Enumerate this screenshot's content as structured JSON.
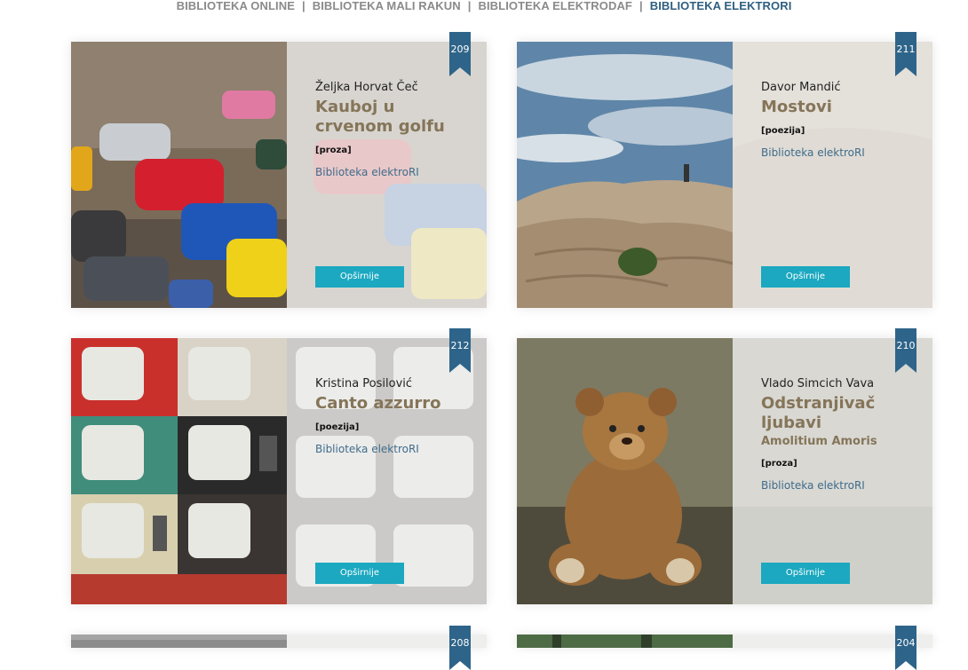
{
  "nav": {
    "items": [
      {
        "label": "BIBLIOTEKA ONLINE"
      },
      {
        "label": "BIBLIOTEKA MALI RAKUN"
      },
      {
        "label": "BIBLIOTEKA ELEKTRODAF"
      },
      {
        "label": "BIBLIOTEKA ELEKTRORI"
      }
    ],
    "separator": "|",
    "active_color": "#2f5f80"
  },
  "cards": [
    {
      "number": "209",
      "author": "Željka Horvat Čeč",
      "title": "Kauboj u crvenom golfu",
      "subtitle": "",
      "genre": "[proza]",
      "library": "Biblioteka elektroRI",
      "button": "Opširnije"
    },
    {
      "number": "211",
      "author": "Davor Mandić",
      "title": "Mostovi",
      "subtitle": "",
      "genre": "[poezija]",
      "library": "Biblioteka elektroRI",
      "button": "Opširnije"
    },
    {
      "number": "212",
      "author": "Kristina Posilović",
      "title": "Canto azzurro",
      "subtitle": "",
      "genre": "[poezija]",
      "library": "Biblioteka elektroRI",
      "button": "Opširnije"
    },
    {
      "number": "210",
      "author": "Vlado Simcich Vava",
      "title": "Odstranjivač ljubavi",
      "subtitle": "Amolitium Amoris",
      "genre": "[proza]",
      "library": "Biblioteka elektroRI",
      "button": "Opširnije"
    },
    {
      "number": "208"
    },
    {
      "number": "204"
    }
  ],
  "colors": {
    "title": "#857559",
    "link": "#3f6c8c",
    "button": "#1ba8c0",
    "ribbon": "#2e6489",
    "card_bg": "#eeeeec"
  },
  "icons": {
    "ribbon": "bookmark-ribbon-icon"
  }
}
